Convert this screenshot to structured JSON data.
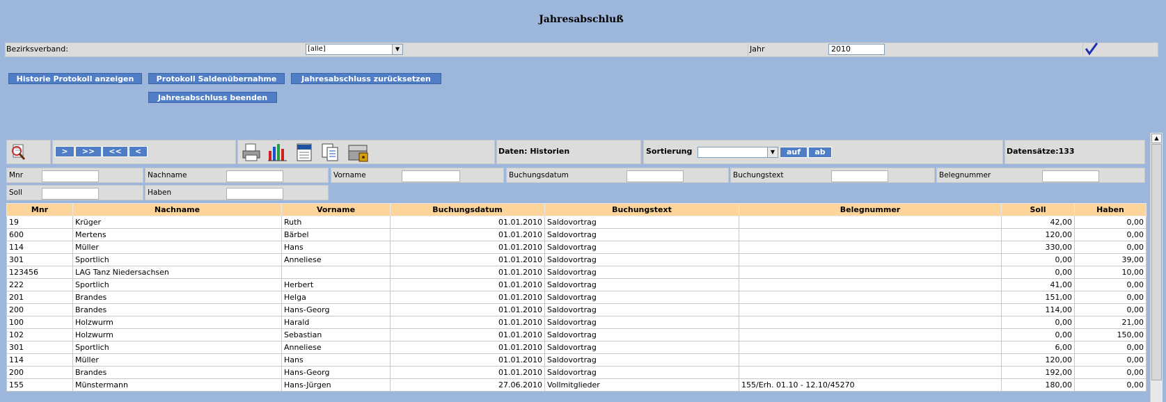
{
  "header": {
    "title": "Jahresabschluß"
  },
  "filterbar": {
    "bezirk_label": "Bezirksverband:",
    "bezirk_value": "[alle]",
    "jahr_label": "Jahr",
    "jahr_value": "2010"
  },
  "actions": {
    "historie": "Historie Protokoll anzeigen",
    "protokoll": "Protokoll Saldenübernahme",
    "zuruecksetzen": "Jahresabschluss zurücksetzen",
    "beenden": "Jahresabschluss beenden"
  },
  "toolbar": {
    "nav": [
      ">",
      ">>",
      "<<",
      "<"
    ],
    "daten_label": "Daten: Historien",
    "sort_label": "Sortierung",
    "sort_value": "",
    "auf": "auf",
    "ab": "ab",
    "count_label": "Datensätze:133"
  },
  "filters": {
    "row1": [
      "Mnr",
      "Nachname",
      "Vorname",
      "Buchungsdatum",
      "Buchungstext",
      "Belegnummer"
    ],
    "row2": [
      "Soll",
      "Haben"
    ]
  },
  "table": {
    "columns": [
      "Mnr",
      "Nachname",
      "Vorname",
      "Buchungsdatum",
      "Buchungstext",
      "Belegnummer",
      "Soll",
      "Haben"
    ],
    "rows": [
      [
        "19",
        "Krüger",
        "Ruth",
        "01.01.2010",
        "Saldovortrag",
        "",
        "42,00",
        "0,00"
      ],
      [
        "600",
        "Mertens",
        "Bärbel",
        "01.01.2010",
        "Saldovortrag",
        "",
        "120,00",
        "0,00"
      ],
      [
        "114",
        "Müller",
        "Hans",
        "01.01.2010",
        "Saldovortrag",
        "",
        "330,00",
        "0,00"
      ],
      [
        "301",
        "Sportlich",
        "Anneliese",
        "01.01.2010",
        "Saldovortrag",
        "",
        "0,00",
        "39,00"
      ],
      [
        "123456",
        "LAG Tanz Niedersachsen",
        "",
        "01.01.2010",
        "Saldovortrag",
        "",
        "0,00",
        "10,00"
      ],
      [
        "222",
        "Sportlich",
        "Herbert",
        "01.01.2010",
        "Saldovortrag",
        "",
        "41,00",
        "0,00"
      ],
      [
        "201",
        "Brandes",
        "Helga",
        "01.01.2010",
        "Saldovortrag",
        "",
        "151,00",
        "0,00"
      ],
      [
        "200",
        "Brandes",
        "Hans-Georg",
        "01.01.2010",
        "Saldovortrag",
        "",
        "114,00",
        "0,00"
      ],
      [
        "100",
        "Holzwurm",
        "Harald",
        "01.01.2010",
        "Saldovortrag",
        "",
        "0,00",
        "21,00"
      ],
      [
        "102",
        "Holzwurm",
        "Sebastian",
        "01.01.2010",
        "Saldovortrag",
        "",
        "0,00",
        "150,00"
      ],
      [
        "301",
        "Sportlich",
        "Anneliese",
        "01.01.2010",
        "Saldovortrag",
        "",
        "6,00",
        "0,00"
      ],
      [
        "114",
        "Müller",
        "Hans",
        "01.01.2010",
        "Saldovortrag",
        "",
        "120,00",
        "0,00"
      ],
      [
        "200",
        "Brandes",
        "Hans-Georg",
        "01.01.2010",
        "Saldovortrag",
        "",
        "192,00",
        "0,00"
      ],
      [
        "155",
        "Münstermann",
        "Hans-Jürgen",
        "27.06.2010",
        "Vollmitglieder",
        "155/Erh. 01.10 - 12.10/45270",
        "180,00",
        "0,00"
      ]
    ]
  },
  "colors": {
    "background": "#9db7dc",
    "button": "#4f7ec6",
    "header": "#fdd49a"
  }
}
